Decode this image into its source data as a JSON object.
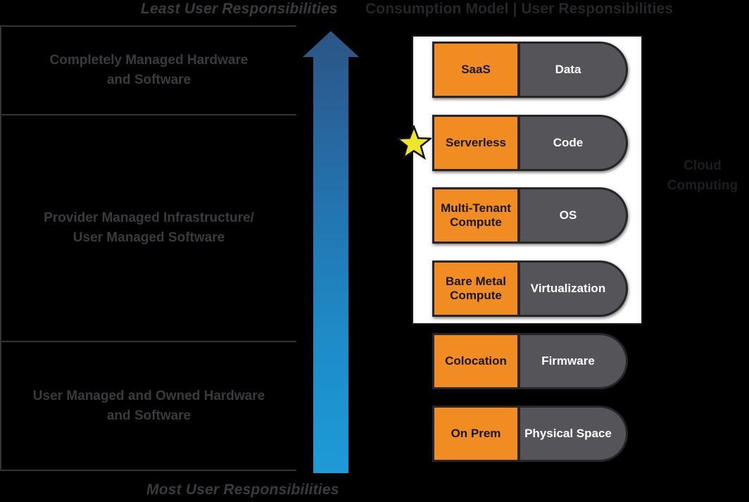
{
  "header": {
    "title": "Consumption Model  |  User Responsibilities"
  },
  "axis": {
    "top_caption": "Least User Responsibilities",
    "bottom_caption": "Most User Responsibilities",
    "arrow_direction": "up",
    "arrow_gradient_top": "#2c5585",
    "arrow_gradient_bottom": "#1d9bd7"
  },
  "responsibility_bands": [
    {
      "label": "Completely Managed Hardware\nand Software"
    },
    {
      "label": "Provider Managed Infrastructure/\nUser Managed Software"
    },
    {
      "label": "User Managed and Owned Hardware\nand Software"
    }
  ],
  "stack": {
    "rows": [
      {
        "model": "SaaS",
        "responsibility": "Data",
        "in_cloud": true,
        "starred": false
      },
      {
        "model": "Serverless",
        "responsibility": "Code",
        "in_cloud": true,
        "starred": true
      },
      {
        "model": "Multi-Tenant\nCompute",
        "responsibility": "OS",
        "in_cloud": true,
        "starred": false
      },
      {
        "model": "Bare Metal\nCompute",
        "responsibility": "Virtualization",
        "in_cloud": true,
        "starred": false
      },
      {
        "model": "Colocation",
        "responsibility": "Firmware",
        "in_cloud": false,
        "starred": false
      },
      {
        "model": "On Prem",
        "responsibility": "Physical Space",
        "in_cloud": false,
        "starred": false
      }
    ]
  },
  "cloud_group": {
    "label": "Cloud\nComputing"
  },
  "colors": {
    "background": "#000000",
    "model_fill": "#f08c22",
    "responsibility_fill": "#555559",
    "outline": "#26262a",
    "cloud_frame": "#ffffff",
    "star_fill": "#efe62c",
    "band_text": "#3a3a3f"
  }
}
